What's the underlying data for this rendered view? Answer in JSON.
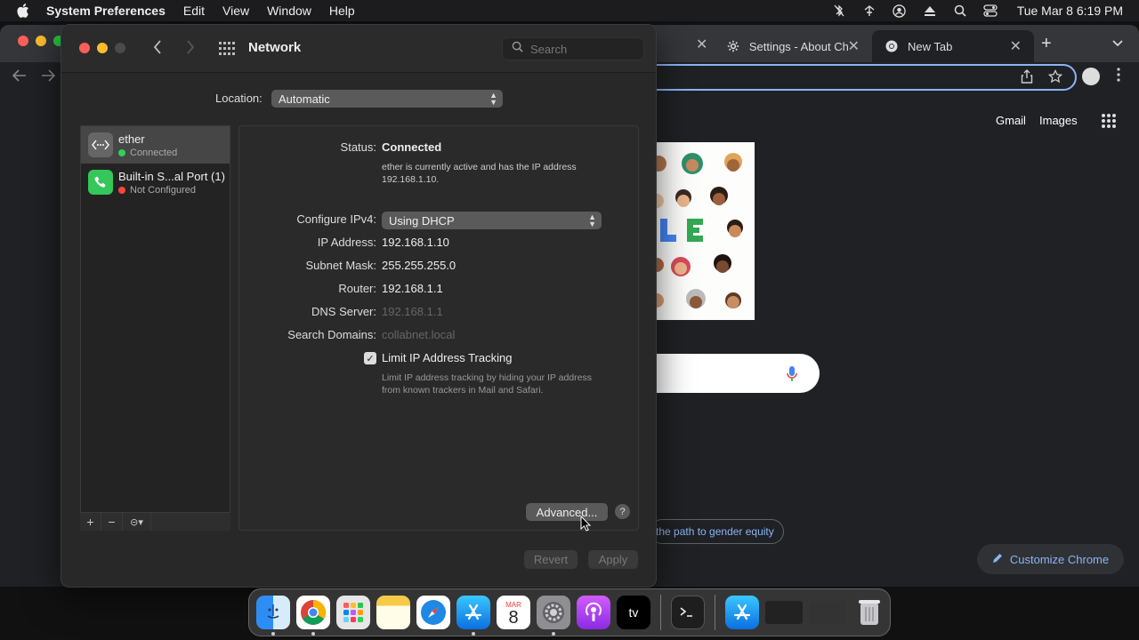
{
  "menubar": {
    "app_name": "System Preferences",
    "items": [
      "Edit",
      "View",
      "Window",
      "Help"
    ],
    "clock": "Tue Mar 8  6:19 PM"
  },
  "chrome": {
    "tabs": [
      {
        "label": "Settings - About Ch"
      },
      {
        "label": "New Tab"
      }
    ],
    "newtab": {
      "gmail": "Gmail",
      "images": "Images",
      "chip": "the path to gender equity",
      "customize": "Customize Chrome"
    }
  },
  "prefs": {
    "title": "Network",
    "search_placeholder": "Search",
    "location_label": "Location:",
    "location_value": "Automatic",
    "services": [
      {
        "name": "ether",
        "status": "Connected",
        "status_color": "#30d158"
      },
      {
        "name": "Built-in S...al Port (1)",
        "status": "Not Configured",
        "status_color": "#ff453a"
      }
    ],
    "detail": {
      "status_label": "Status:",
      "status_value": "Connected",
      "status_note_1": "ether is currently active and has the IP address",
      "status_note_2": "192.168.1.10.",
      "ipv4_label": "Configure IPv4:",
      "ipv4_value": "Using DHCP",
      "ip_label": "IP Address:",
      "ip_value": "192.168.1.10",
      "mask_label": "Subnet Mask:",
      "mask_value": "255.255.255.0",
      "router_label": "Router:",
      "router_value": "192.168.1.1",
      "dns_label": "DNS Server:",
      "dns_value": "192.168.1.1",
      "domains_label": "Search Domains:",
      "domains_value": "collabnet.local",
      "limit_label": "Limit IP Address Tracking",
      "limit_note_1": "Limit IP address tracking by hiding your IP address",
      "limit_note_2": "from known trackers in Mail and Safari."
    },
    "advanced_label": "Advanced...",
    "help_label": "?",
    "revert_label": "Revert",
    "apply_label": "Apply"
  },
  "dock": {
    "calendar_month": "MAR",
    "calendar_day": "8",
    "tv_label": "tv"
  }
}
